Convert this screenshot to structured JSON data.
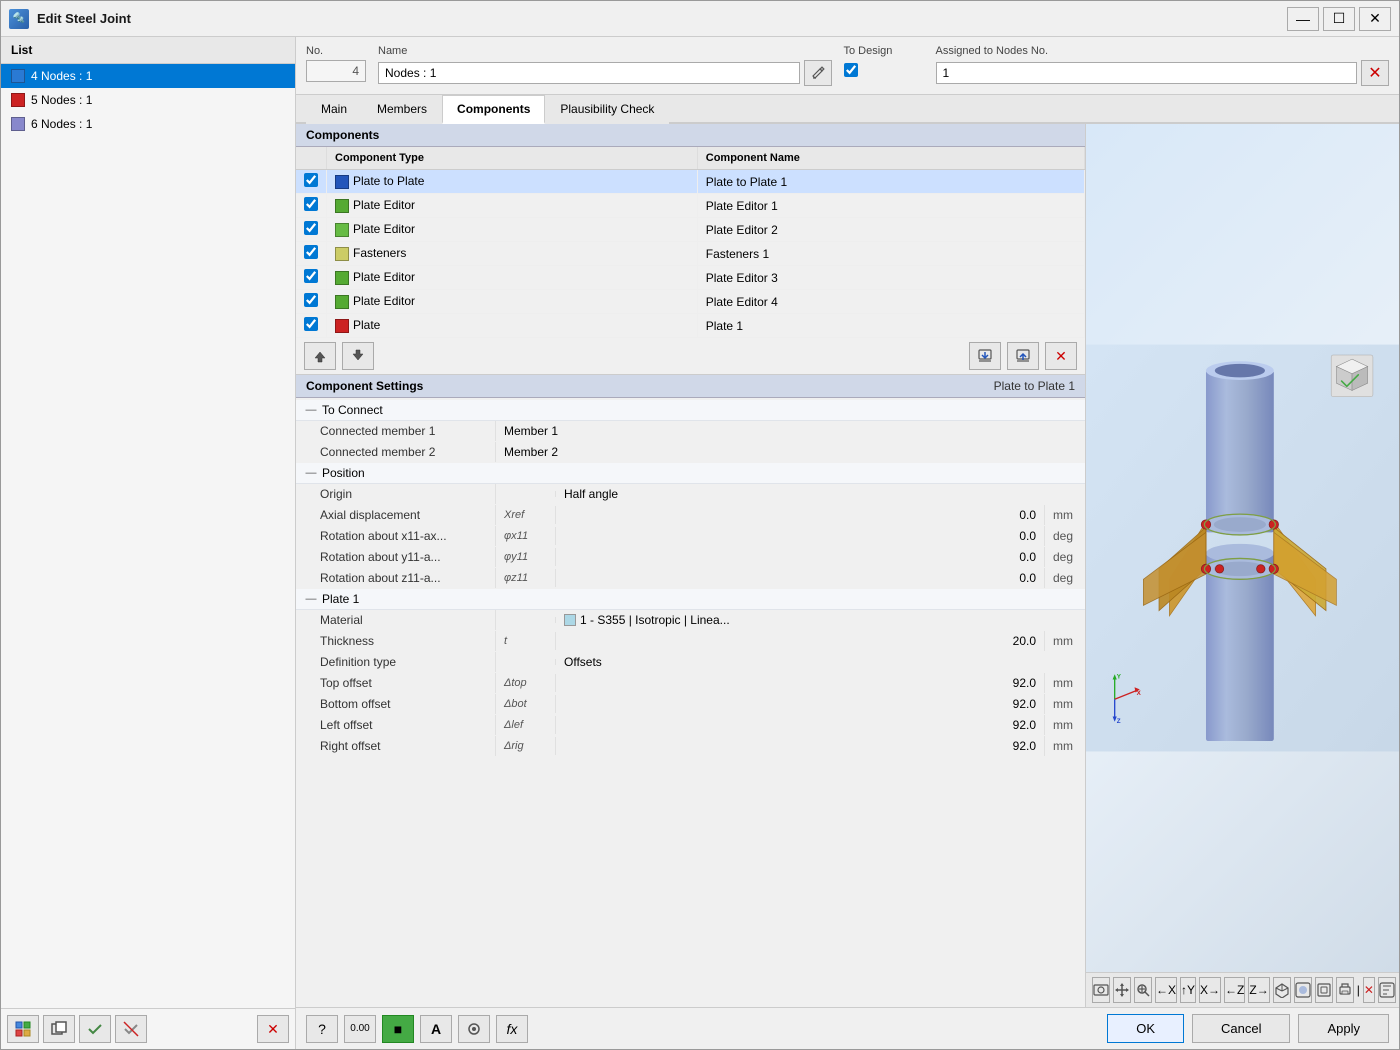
{
  "window": {
    "title": "Edit Steel Joint",
    "icon": "🔩"
  },
  "list": {
    "header": "List",
    "items": [
      {
        "id": 4,
        "label": "4  Nodes : 1",
        "color": "#2a7ad4",
        "selected": true
      },
      {
        "id": 5,
        "label": "5  Nodes : 1",
        "color": "#cc2222",
        "selected": false
      },
      {
        "id": 6,
        "label": "6  Nodes : 1",
        "color": "#8888cc",
        "selected": false
      }
    ]
  },
  "header": {
    "no_label": "No.",
    "no_value": "4",
    "name_label": "Name",
    "name_value": "Nodes : 1",
    "to_design_label": "To Design",
    "to_design_checked": true,
    "assigned_label": "Assigned to Nodes No.",
    "assigned_value": "1"
  },
  "tabs": {
    "items": [
      "Main",
      "Members",
      "Components",
      "Plausibility Check"
    ],
    "active": "Components"
  },
  "components": {
    "section_label": "Components",
    "table_headers": [
      "",
      "Component Type",
      "Component Name"
    ],
    "rows": [
      {
        "checked": true,
        "color": "#2255bb",
        "type": "Plate to Plate",
        "name": "Plate to Plate 1",
        "selected": true
      },
      {
        "checked": true,
        "color": "#55aa33",
        "type": "Plate Editor",
        "name": "Plate Editor 1",
        "selected": false
      },
      {
        "checked": true,
        "color": "#66bb44",
        "type": "Plate Editor",
        "name": "Plate Editor 2",
        "selected": false
      },
      {
        "checked": true,
        "color": "#cccc66",
        "type": "Fasteners",
        "name": "Fasteners 1",
        "selected": false
      },
      {
        "checked": true,
        "color": "#55aa33",
        "type": "Plate Editor",
        "name": "Plate Editor 3",
        "selected": false
      },
      {
        "checked": true,
        "color": "#55aa33",
        "type": "Plate Editor",
        "name": "Plate Editor 4",
        "selected": false
      },
      {
        "checked": true,
        "color": "#cc2222",
        "type": "Plate",
        "name": "Plate 1",
        "selected": false
      }
    ]
  },
  "component_settings": {
    "title": "Component Settings",
    "selected_name": "Plate to Plate 1",
    "groups": [
      {
        "label": "To Connect",
        "collapsed": false,
        "rows": [
          {
            "label": "Connected member 1",
            "symbol": "",
            "value": "Member 1",
            "unit": "",
            "type": "text"
          },
          {
            "label": "Connected member 2",
            "symbol": "",
            "value": "Member 2",
            "unit": "",
            "type": "text"
          }
        ]
      },
      {
        "label": "Position",
        "collapsed": false,
        "rows": [
          {
            "label": "Origin",
            "symbol": "",
            "value": "Half angle",
            "unit": "",
            "type": "text"
          },
          {
            "label": "Axial displacement",
            "symbol": "Xref",
            "value": "0.0",
            "unit": "mm",
            "type": "number"
          },
          {
            "label": "Rotation about x11-ax...",
            "symbol": "φx11",
            "value": "0.0",
            "unit": "deg",
            "type": "number"
          },
          {
            "label": "Rotation about y11-a...",
            "symbol": "φy11",
            "value": "0.0",
            "unit": "deg",
            "type": "number"
          },
          {
            "label": "Rotation about z11-a...",
            "symbol": "φz11",
            "value": "0.0",
            "unit": "deg",
            "type": "number"
          }
        ]
      },
      {
        "label": "Plate 1",
        "collapsed": false,
        "rows": [
          {
            "label": "Material",
            "symbol": "",
            "value": "1 - S355 | Isotropic | Linea...",
            "unit": "",
            "type": "material"
          },
          {
            "label": "Thickness",
            "symbol": "t",
            "value": "20.0",
            "unit": "mm",
            "type": "number"
          },
          {
            "label": "Definition type",
            "symbol": "",
            "value": "Offsets",
            "unit": "",
            "type": "text"
          },
          {
            "label": "Top offset",
            "symbol": "Δtop",
            "value": "92.0",
            "unit": "mm",
            "type": "number"
          },
          {
            "label": "Bottom offset",
            "symbol": "Δbot",
            "value": "92.0",
            "unit": "mm",
            "type": "number"
          },
          {
            "label": "Left offset",
            "symbol": "Δlef",
            "value": "92.0",
            "unit": "mm",
            "type": "number"
          },
          {
            "label": "Right offset",
            "symbol": "Δrig",
            "value": "92.0",
            "unit": "mm",
            "type": "number"
          }
        ]
      }
    ]
  },
  "bottom_toolbar": {
    "icons": [
      "?",
      "0.00",
      "■",
      "A",
      "👁",
      "fx"
    ]
  },
  "dialog_buttons": {
    "ok": "OK",
    "cancel": "Cancel",
    "apply": "Apply"
  },
  "view_toolbar_icons": [
    "⊞",
    "↕",
    "🔍",
    "←",
    "↑",
    "→",
    "↓",
    "Z",
    "↙",
    "↗",
    "□",
    "⧉",
    "🖨",
    "×",
    "📋"
  ]
}
